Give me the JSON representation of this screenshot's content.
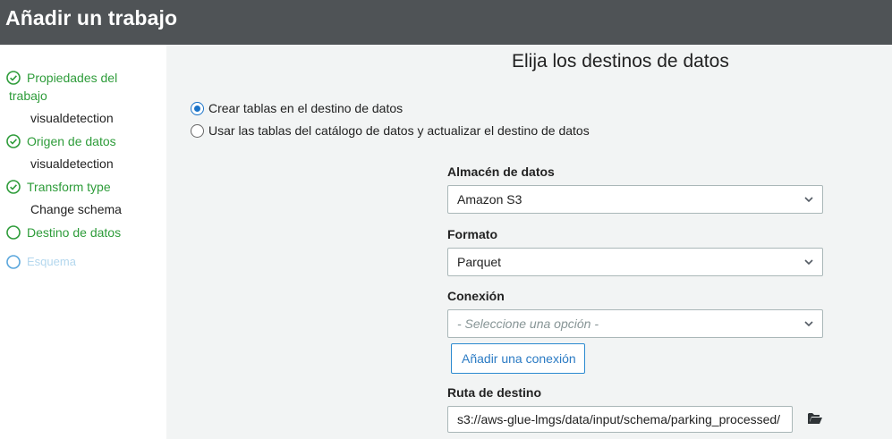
{
  "header": {
    "title": "Añadir un trabajo"
  },
  "sidebar": {
    "steps": [
      {
        "label": "Propiedades del trabajo",
        "sub": "visualdetection",
        "state": "done"
      },
      {
        "label": "Origen de datos",
        "sub": "visualdetection",
        "state": "done"
      },
      {
        "label": "Transform type",
        "sub": "Change schema",
        "state": "done"
      },
      {
        "label": "Destino de datos",
        "sub": "",
        "state": "current"
      },
      {
        "label": "Esquema",
        "sub": "",
        "state": "disabled"
      }
    ],
    "step1_line1": "Propiedades del",
    "step1_line2": "trabajo"
  },
  "main": {
    "title": "Elija los destinos de datos",
    "radio_options": [
      {
        "label": "Crear tablas en el destino de datos",
        "checked": true
      },
      {
        "label": "Usar las tablas del catálogo de datos y actualizar el destino de datos",
        "checked": false
      }
    ],
    "store": {
      "label": "Almacén de datos",
      "value": "Amazon S3"
    },
    "format": {
      "label": "Formato",
      "value": "Parquet"
    },
    "connection": {
      "label": "Conexión",
      "placeholder": "- Seleccione una opción -"
    },
    "add_connection_label": "Añadir una conexión",
    "target_path": {
      "label": "Ruta de destino",
      "value": "s3://aws-glue-lmgs/data/input/schema/parking_processed/"
    }
  },
  "colors": {
    "header_bg": "#4f5356",
    "done_green": "#2e9c3a",
    "disabled_blue": "#b3d7ee",
    "accent_blue": "#1a73c8",
    "main_bg": "#f2f4f4"
  },
  "icons": [
    "check-circle-icon",
    "empty-circle-icon",
    "chevron-down-icon",
    "folder-open-icon"
  ]
}
